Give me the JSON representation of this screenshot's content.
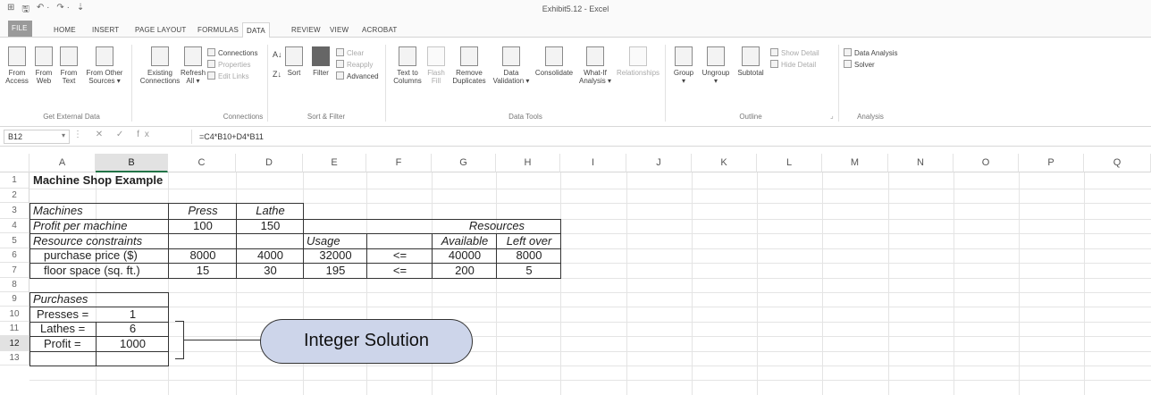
{
  "window": {
    "title": "Exhibit5.12 - Excel",
    "qat": [
      "⊞",
      "🖫",
      "↶ ·",
      "↷ ·",
      "⇣"
    ]
  },
  "tabs": [
    "FILE",
    "HOME",
    "INSERT",
    "PAGE LAYOUT",
    "FORMULAS",
    "DATA",
    "REVIEW",
    "VIEW",
    "ACROBAT"
  ],
  "active_tab": "DATA",
  "ribbon": {
    "from_access": "From\nAccess",
    "from_web": "From\nWeb",
    "from_text": "From\nText",
    "from_other": "From Other\nSources ▾",
    "existing": "Existing\nConnections",
    "refresh": "Refresh\nAll ▾",
    "connections": "Connections",
    "properties": "Properties",
    "edit_links": "Edit Links",
    "sort": "Sort",
    "filter": "Filter",
    "clear": "Clear",
    "reapply": "Reapply",
    "advanced": "Advanced",
    "text_to_columns": "Text to\nColumns",
    "flash_fill": "Flash\nFill",
    "remove_dup": "Remove\nDuplicates",
    "data_validation": "Data\nValidation ▾",
    "consolidate": "Consolidate",
    "what_if": "What-If\nAnalysis ▾",
    "relationships": "Relationships",
    "group": "Group\n▾",
    "ungroup": "Ungroup\n▾",
    "subtotal": "Subtotal",
    "show_detail": "Show Detail",
    "hide_detail": "Hide Detail",
    "data_analysis": "Data Analysis",
    "solver": "Solver",
    "groups": {
      "get_external": "Get External Data",
      "connections": "Connections",
      "sort_filter": "Sort & Filter",
      "data_tools": "Data Tools",
      "outline": "Outline",
      "analysis": "Analysis"
    }
  },
  "formula_bar": {
    "name_box": "B12",
    "name_arrow": "▾",
    "buttons": "⋮ ✕ ✓ fx",
    "formula": "=C4*B10+D4*B11"
  },
  "columns": [
    "A",
    "B",
    "C",
    "D",
    "E",
    "F",
    "G",
    "H",
    "I",
    "J",
    "K",
    "L",
    "M",
    "N",
    "O",
    "P",
    "Q"
  ],
  "selected_column": "B",
  "rows": [
    "1",
    "2",
    "3",
    "4",
    "5",
    "6",
    "7",
    "8",
    "9",
    "10",
    "11",
    "12",
    "13"
  ],
  "selected_row": "12",
  "cells": {
    "a1": "Machine Shop Example",
    "a3": "Machines",
    "c3": "Press",
    "d3": "Lathe",
    "a4": "Profit per machine",
    "c4": "100",
    "d4": "150",
    "g4": "Resources",
    "a5": "Resource constraints",
    "e5": "Usage",
    "g5": "Available",
    "h5": "Left over",
    "a6": "purchase price ($)",
    "c6": "8000",
    "d6": "4000",
    "e6": "32000",
    "f6": "<=",
    "g6": "40000",
    "h6": "8000",
    "a7": "floor space (sq. ft.)",
    "c7": "15",
    "d7": "30",
    "e7": "195",
    "f7": "<=",
    "g7": "200",
    "h7": "5",
    "a9": "Purchases",
    "a10": "Presses =",
    "b10": "1",
    "a11": "Lathes =",
    "b11": "6",
    "a12": "Profit =",
    "b12": "1000"
  },
  "callout": "Integer Solution"
}
